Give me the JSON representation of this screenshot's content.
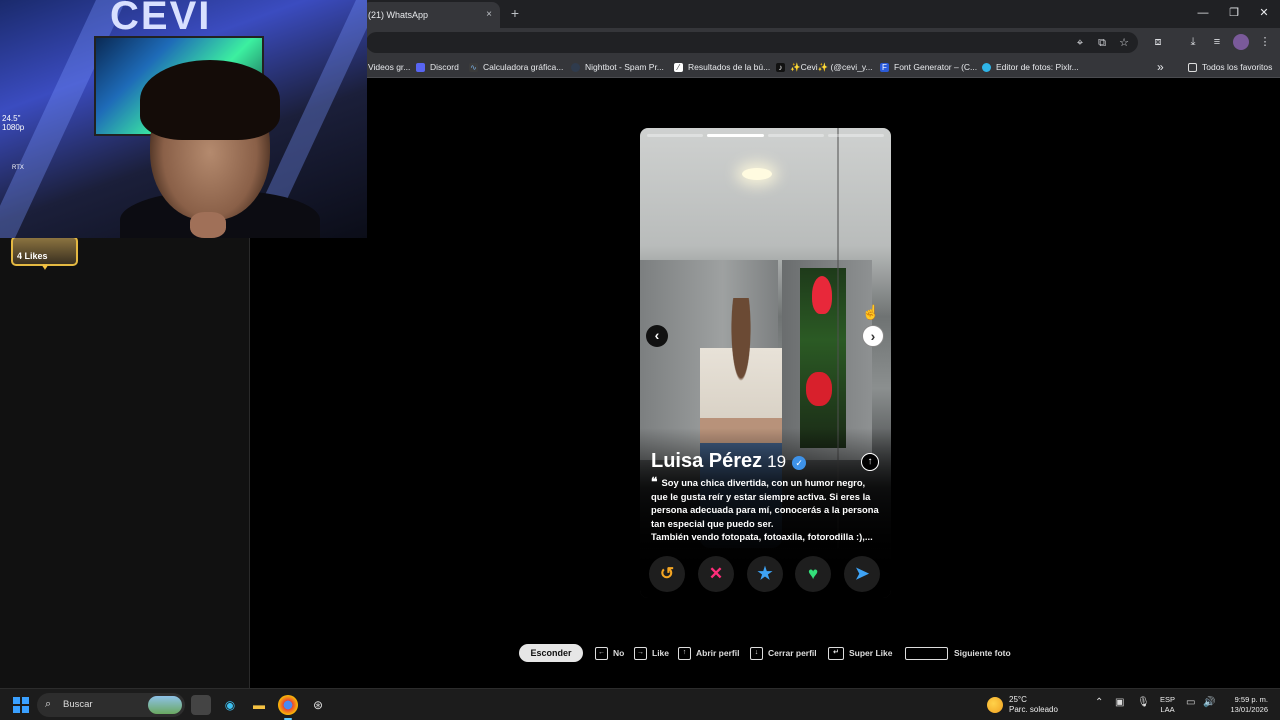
{
  "browser": {
    "tab_title": "(21) WhatsApp",
    "tab_close": "×",
    "new_tab": "+",
    "bookmarks": [
      {
        "label": "Videos gr...",
        "icon": "video-icon"
      },
      {
        "label": "Discord",
        "icon": "discord-icon"
      },
      {
        "label": "Calculadora gráfica...",
        "icon": "desmos-icon"
      },
      {
        "label": "Nightbot - Spam Pr...",
        "icon": "nightbot-icon"
      },
      {
        "label": "Resultados de la bú...",
        "icon": "results-icon"
      },
      {
        "label": "✨Cevi✨ (@cevi_y...",
        "icon": "tiktok-icon"
      },
      {
        "label": "Font Generator – (C...",
        "icon": "font-icon"
      },
      {
        "label": "Editor de fotos: Pixlr...",
        "icon": "pixlr-icon"
      }
    ],
    "more_bookmarks": "»",
    "all_favorites": "Todos los favoritos"
  },
  "left_panel": {
    "likes_label": "4 Likes"
  },
  "webcam": {
    "logo_text": "CEVI",
    "monitor_label_line1": "24.5\"",
    "monitor_label_line2": "1080p",
    "gpu_label": "RTX"
  },
  "profile": {
    "name": "Luisa Pérez",
    "age": "19",
    "verified": true,
    "photo_count": 4,
    "current_photo": 2,
    "bio_lines": [
      "Soy una chica divertida, con un humor negro,",
      "que le gusta reír y estar siempre activa. Si eres la",
      "persona adecuada para mí, conocerás a la persona",
      "tan especial que puedo ser.",
      "También vendo fotopata, fotoaxila, fotorodilla :),..."
    ],
    "quote_mark": "❝"
  },
  "actions": [
    {
      "name": "rewind-button",
      "icon": "rewind-icon",
      "glyph": "↺",
      "color": "#f5a623"
    },
    {
      "name": "nope-button",
      "icon": "x-icon",
      "glyph": "✕",
      "color": "#ff2d7a"
    },
    {
      "name": "super-like-button",
      "icon": "star-icon",
      "glyph": "★",
      "color": "#3ea3f5"
    },
    {
      "name": "like-button",
      "icon": "heart-icon",
      "glyph": "♥",
      "color": "#33e07a"
    },
    {
      "name": "boost-button",
      "icon": "send-icon",
      "glyph": "➤",
      "color": "#3ea3f5"
    }
  ],
  "shortcuts": {
    "hide": "Esconder",
    "items": [
      {
        "key": "←",
        "label": "No"
      },
      {
        "key": "→",
        "label": "Like"
      },
      {
        "key": "↑",
        "label": "Abrir perfil"
      },
      {
        "key": "↓",
        "label": "Cerrar perfil"
      },
      {
        "key": "↵",
        "label": "Super Like"
      },
      {
        "key": "",
        "label": "Siguiente foto"
      }
    ]
  },
  "taskbar": {
    "search_placeholder": "Buscar",
    "weather_temp": "25°C",
    "weather_desc": "Parc. soleado",
    "lang_line1": "ESP",
    "lang_line2": "LAA",
    "time": "9:59 p. m.",
    "date": "13/01/2026"
  },
  "colors": {
    "verified": "#3e92e8",
    "likes_border": "#e4b942",
    "hide_button": "#e6e6e6"
  }
}
